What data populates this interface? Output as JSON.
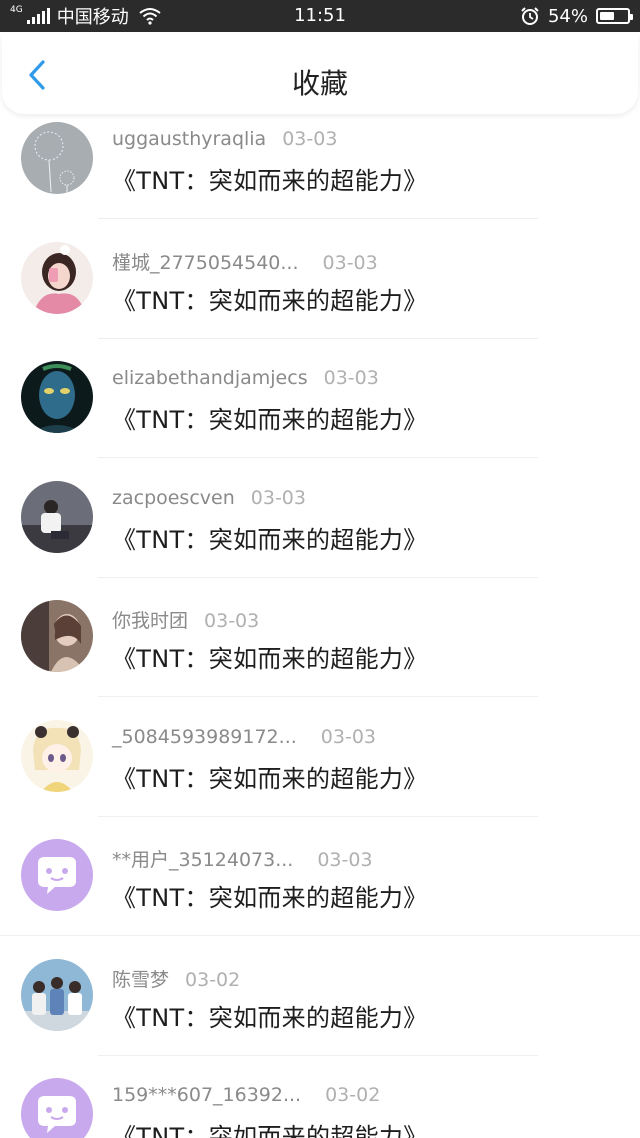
{
  "status_bar": {
    "network": "4G",
    "carrier": "中国移动",
    "time": "11:51",
    "battery_percent_text": "54%",
    "battery_level": 0.54
  },
  "header": {
    "title": "收藏",
    "back_icon": "chevron-left-icon",
    "accent_color": "#2f9be8"
  },
  "items": [
    {
      "user": "uggausthyraqlia",
      "date": "03-03",
      "title": "《TNT：突如而来的超能力》",
      "avatar": "dandelion"
    },
    {
      "user": "槿城_2775054540...",
      "date": "03-03",
      "title": "《TNT：突如而来的超能力》",
      "avatar": "girl-pink"
    },
    {
      "user": "elizabethandjamjecs",
      "date": "03-03",
      "title": "《TNT：突如而来的超能力》",
      "avatar": "avatar-blue-face"
    },
    {
      "user": "zacpoescven",
      "date": "03-03",
      "title": "《TNT：突如而来的超能力》",
      "avatar": "sitting-person"
    },
    {
      "user": "你我时团",
      "date": "03-03",
      "title": "《TNT：突如而来的超能力》",
      "avatar": "girl-sepia"
    },
    {
      "user": "_5084593989172...",
      "date": "03-03",
      "title": "《TNT：突如而来的超能力》",
      "avatar": "anime-girl"
    },
    {
      "user": "**用户_35124073...",
      "date": "03-03",
      "title": "《TNT：突如而来的超能力》",
      "avatar": "default-chat"
    },
    {
      "user": "陈雪梦",
      "date": "03-02",
      "title": "《TNT：突如而来的超能力》",
      "avatar": "group-photo"
    },
    {
      "user": "159***607_16392...",
      "date": "03-02",
      "title": "《TNT：突如而来的超能力》",
      "avatar": "default-chat"
    }
  ]
}
